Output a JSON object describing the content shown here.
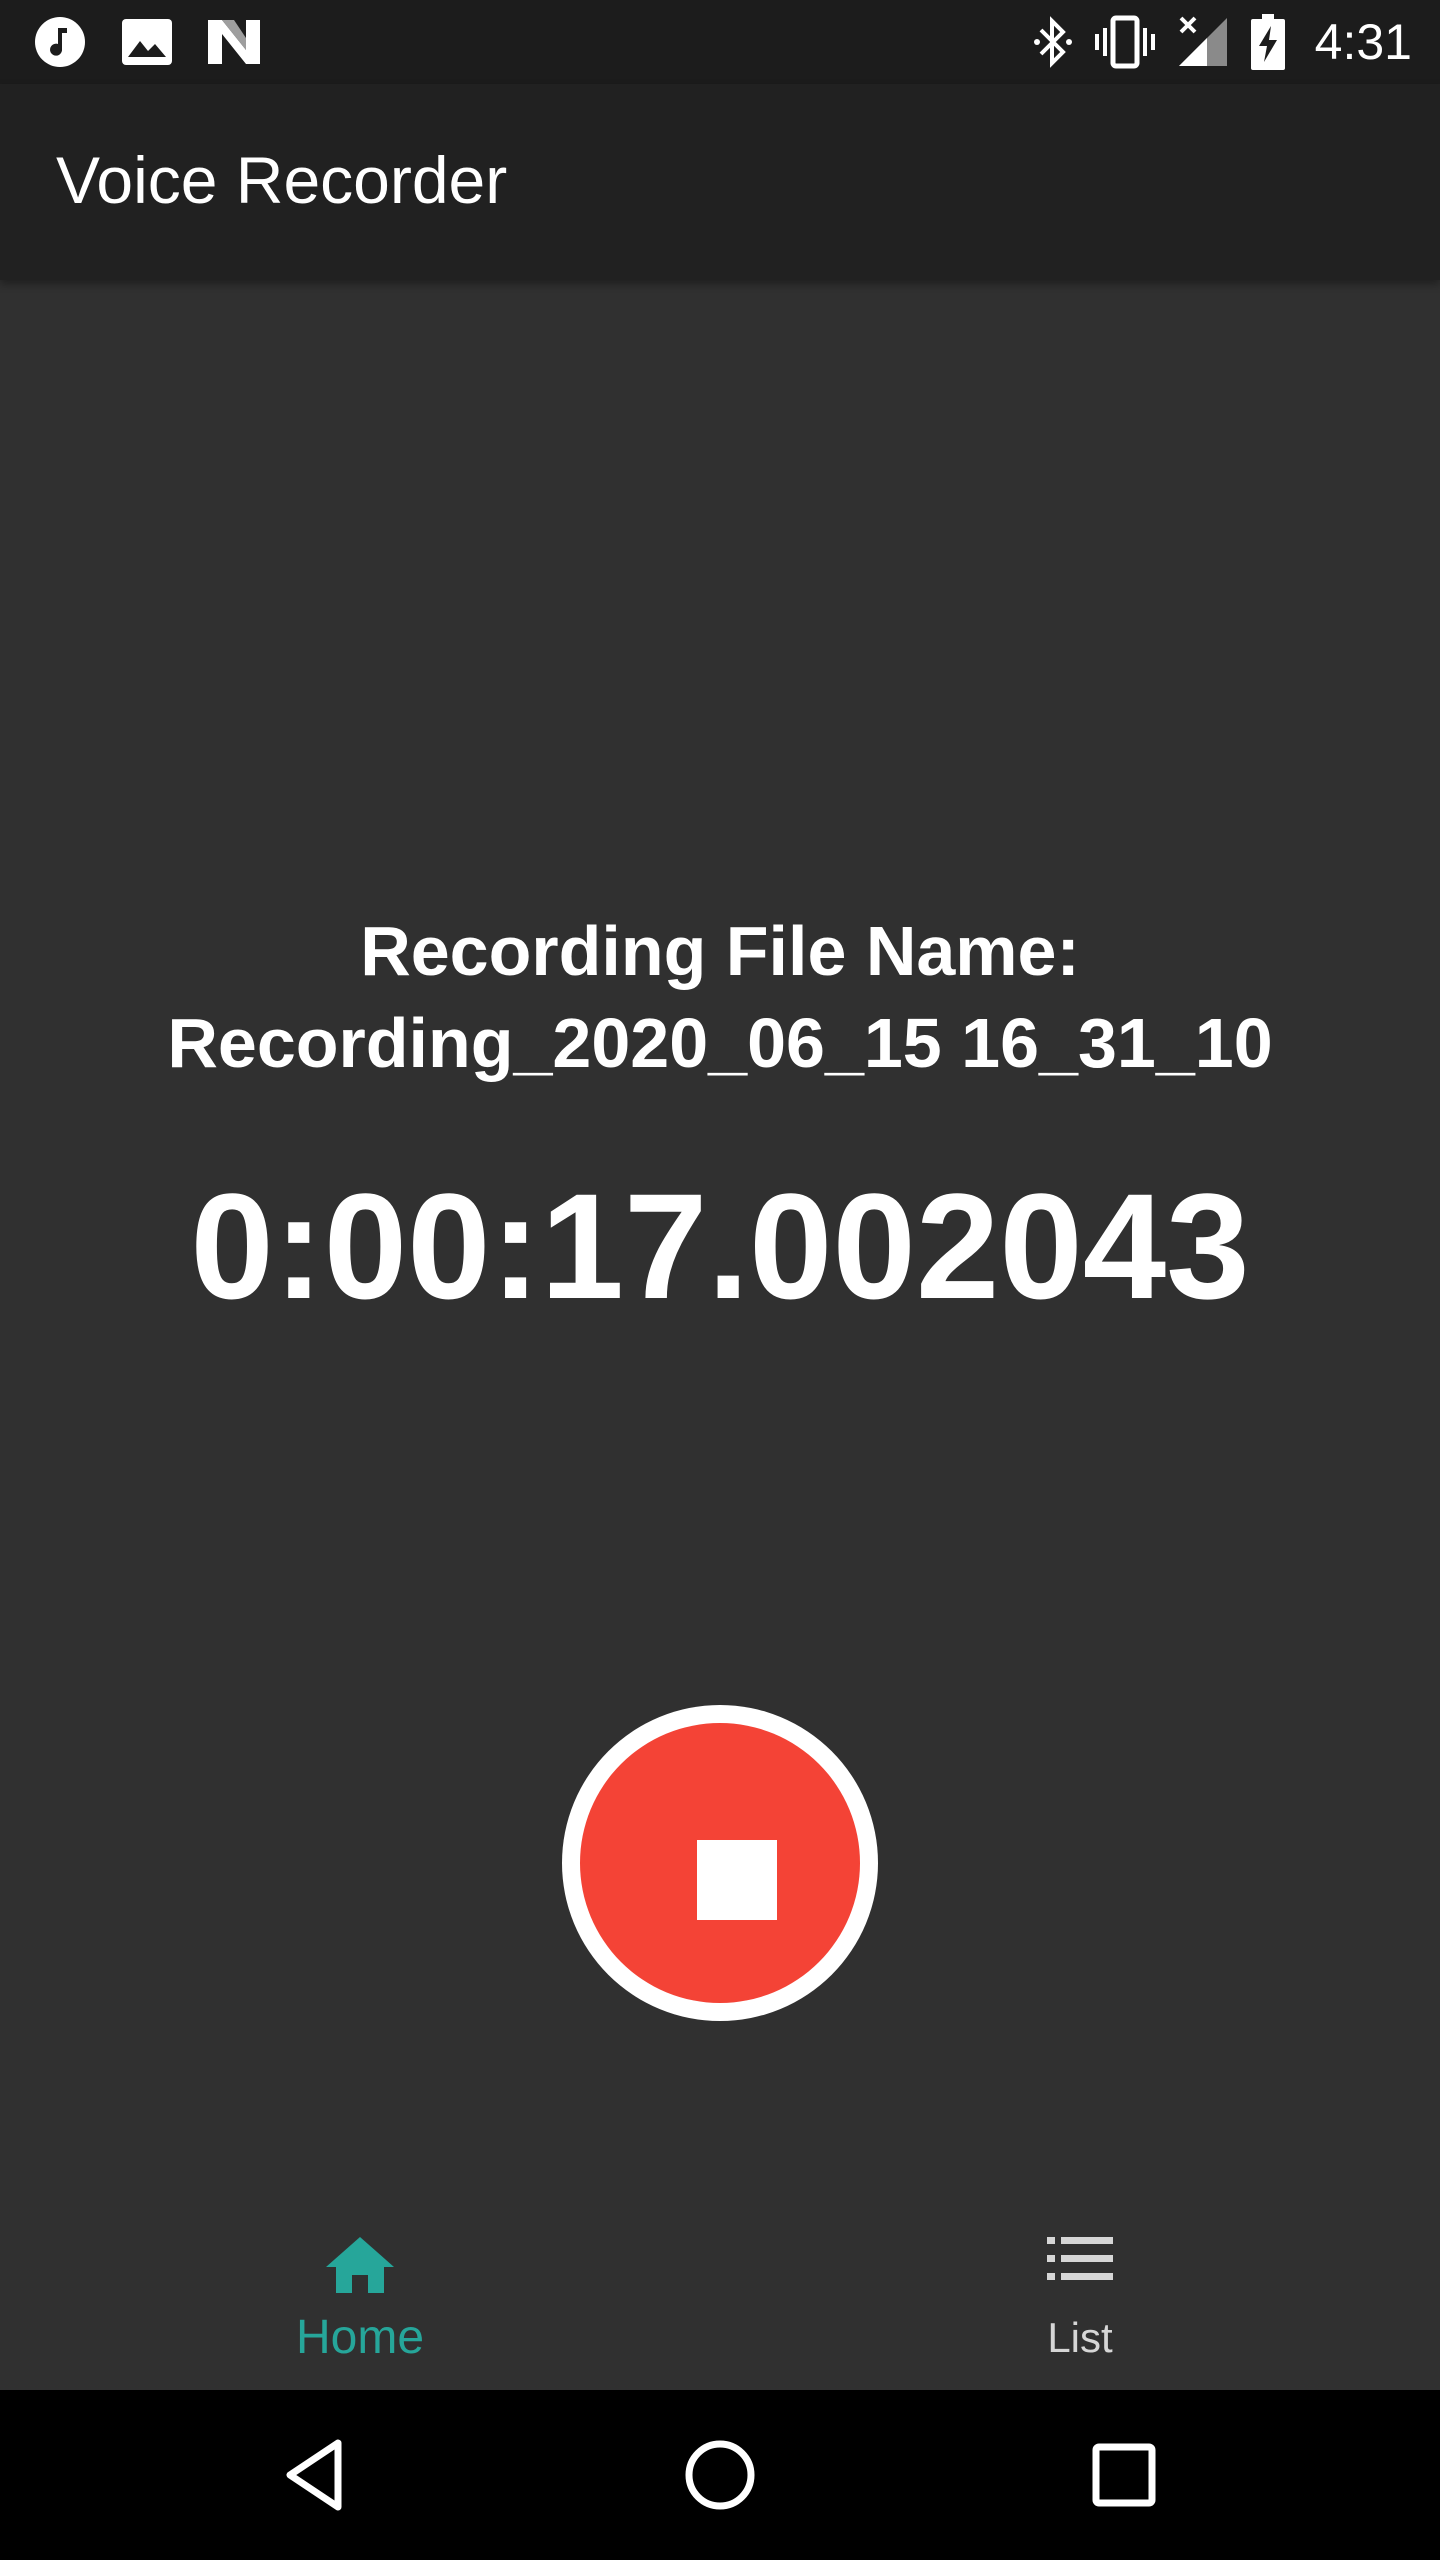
{
  "status_bar": {
    "time": "4:31",
    "left_icons": [
      "music-note-icon",
      "image-icon",
      "n-logo-icon"
    ],
    "right_icons": [
      "bluetooth-icon",
      "vibrate-icon",
      "signal-icon",
      "battery-charging-icon"
    ]
  },
  "app_bar": {
    "title": "Voice Recorder"
  },
  "recording": {
    "file_name_label": "Recording File Name:",
    "file_name": "Recording_2020_06_15 16_31_10",
    "elapsed": "0:00:17.002043"
  },
  "bottom_nav": {
    "items": [
      {
        "label": "Home",
        "icon": "home-icon",
        "selected": true
      },
      {
        "label": "List",
        "icon": "list-icon",
        "selected": false
      }
    ]
  },
  "colors": {
    "accent": "#26a69a",
    "record_button": "#f44336",
    "background": "#303030",
    "app_bar": "#212121"
  }
}
